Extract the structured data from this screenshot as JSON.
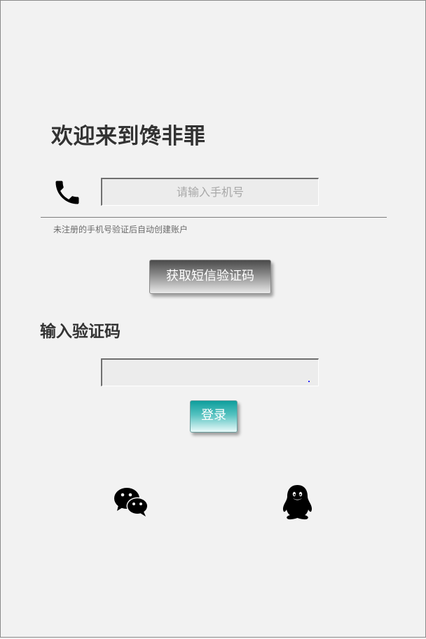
{
  "header": {
    "welcome_text": "欢迎来到馋非罪"
  },
  "phone": {
    "icon": "phone-icon",
    "placeholder": "请输入手机号",
    "value": ""
  },
  "hint_text": "未注册的手机号验证后自动创建账户",
  "sms_button_label": "获取短信验证码",
  "code": {
    "title": "输入验证码",
    "value": ""
  },
  "login_button_label": "登录",
  "social": {
    "wechat_icon": "wechat-icon",
    "qq_icon": "qq-icon"
  },
  "colors": {
    "background": "#f2f2f2",
    "text_dark": "#333333",
    "hint_text": "#6b6b6b",
    "login_teal": "#0e9e9c"
  }
}
